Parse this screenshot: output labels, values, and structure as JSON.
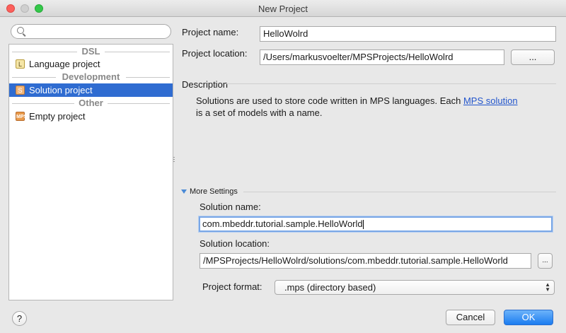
{
  "window": {
    "title": "New Project"
  },
  "search": {
    "placeholder": "",
    "value": ""
  },
  "tree": {
    "groups": [
      {
        "header": "DSL",
        "items": [
          {
            "label": "Language project",
            "icon": "L"
          }
        ]
      },
      {
        "header": "Development",
        "items": [
          {
            "label": "Solution project",
            "icon": "S",
            "selected": true
          }
        ]
      },
      {
        "header": "Other",
        "items": [
          {
            "label": "Empty project",
            "icon": "MPS"
          }
        ]
      }
    ]
  },
  "form": {
    "project_name_label": "Project name:",
    "project_name_value": "HelloWolrd",
    "project_location_label": "Project location:",
    "project_location_value": "/Users/markusvoelter/MPSProjects/HelloWolrd",
    "browse_label": "...",
    "description_title": "Description",
    "description_text": "Solutions are used to store code written in MPS languages. Each ",
    "description_link": "MPS solution",
    "description_text2": "is a set of models with a name.",
    "more_settings": "More Settings",
    "solution_name_label": "Solution name:",
    "solution_name_value": "com.mbeddr.tutorial.sample.HelloWorld",
    "solution_location_label": "Solution location:",
    "solution_location_value": "/MPSProjects/HelloWolrd/solutions/com.mbeddr.tutorial.sample.HelloWorld",
    "solution_browse_label": "...",
    "project_format_label": "Project format:",
    "project_format_value": ".mps (directory based)"
  },
  "footer": {
    "help_label": "?",
    "cancel_label": "Cancel",
    "ok_label": "OK"
  },
  "colors": {
    "selection": "#2f6cd1",
    "link": "#2255cc",
    "primary": "#1b7cf0"
  }
}
